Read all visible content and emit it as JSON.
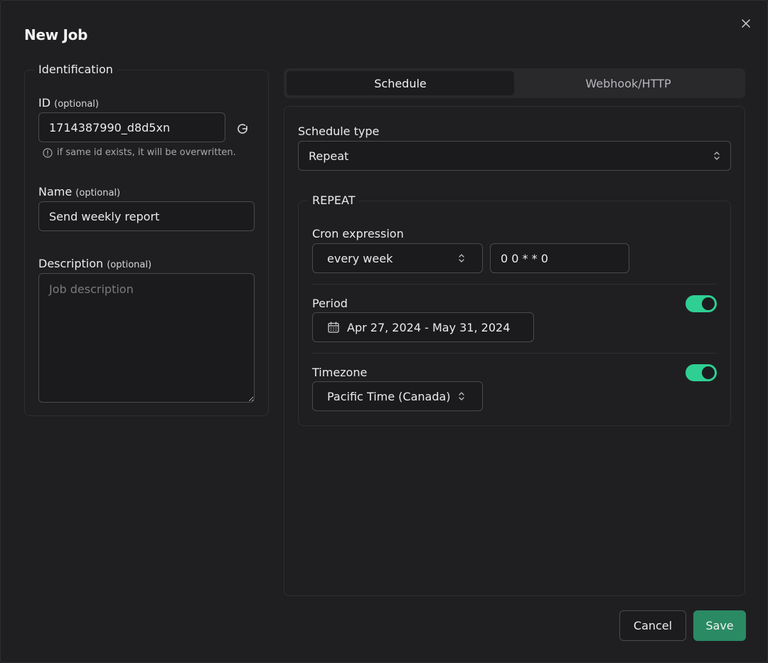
{
  "dialog": {
    "title": "New Job",
    "close_icon": "close-icon"
  },
  "identification": {
    "legend": "Identification",
    "id": {
      "label": "ID",
      "optional": "(optional)",
      "value": "1714387990_d8d5xn",
      "hint": "if same id exists, it will be overwritten.",
      "refresh_icon": "refresh-icon"
    },
    "name": {
      "label": "Name",
      "optional": "(optional)",
      "value": "Send weekly report"
    },
    "description": {
      "label": "Description",
      "optional": "(optional)",
      "placeholder": "Job description",
      "value": ""
    }
  },
  "tabs": [
    {
      "label": "Schedule",
      "active": true
    },
    {
      "label": "Webhook/HTTP",
      "active": false
    }
  ],
  "schedule": {
    "type_label": "Schedule type",
    "type_value": "Repeat",
    "repeat": {
      "legend": "REPEAT",
      "cron_label": "Cron expression",
      "cron_preset": "every week",
      "cron_value": "0 0 * * 0",
      "period_label": "Period",
      "period_enabled": true,
      "period_value": "Apr 27, 2024 - May 31, 2024",
      "timezone_label": "Timezone",
      "timezone_enabled": true,
      "timezone_value": "Pacific Time (Canada)"
    }
  },
  "footer": {
    "cancel_label": "Cancel",
    "save_label": "Save"
  },
  "colors": {
    "accent": "#2fcf94",
    "save": "#2a8a64",
    "background": "#1f1f21"
  }
}
